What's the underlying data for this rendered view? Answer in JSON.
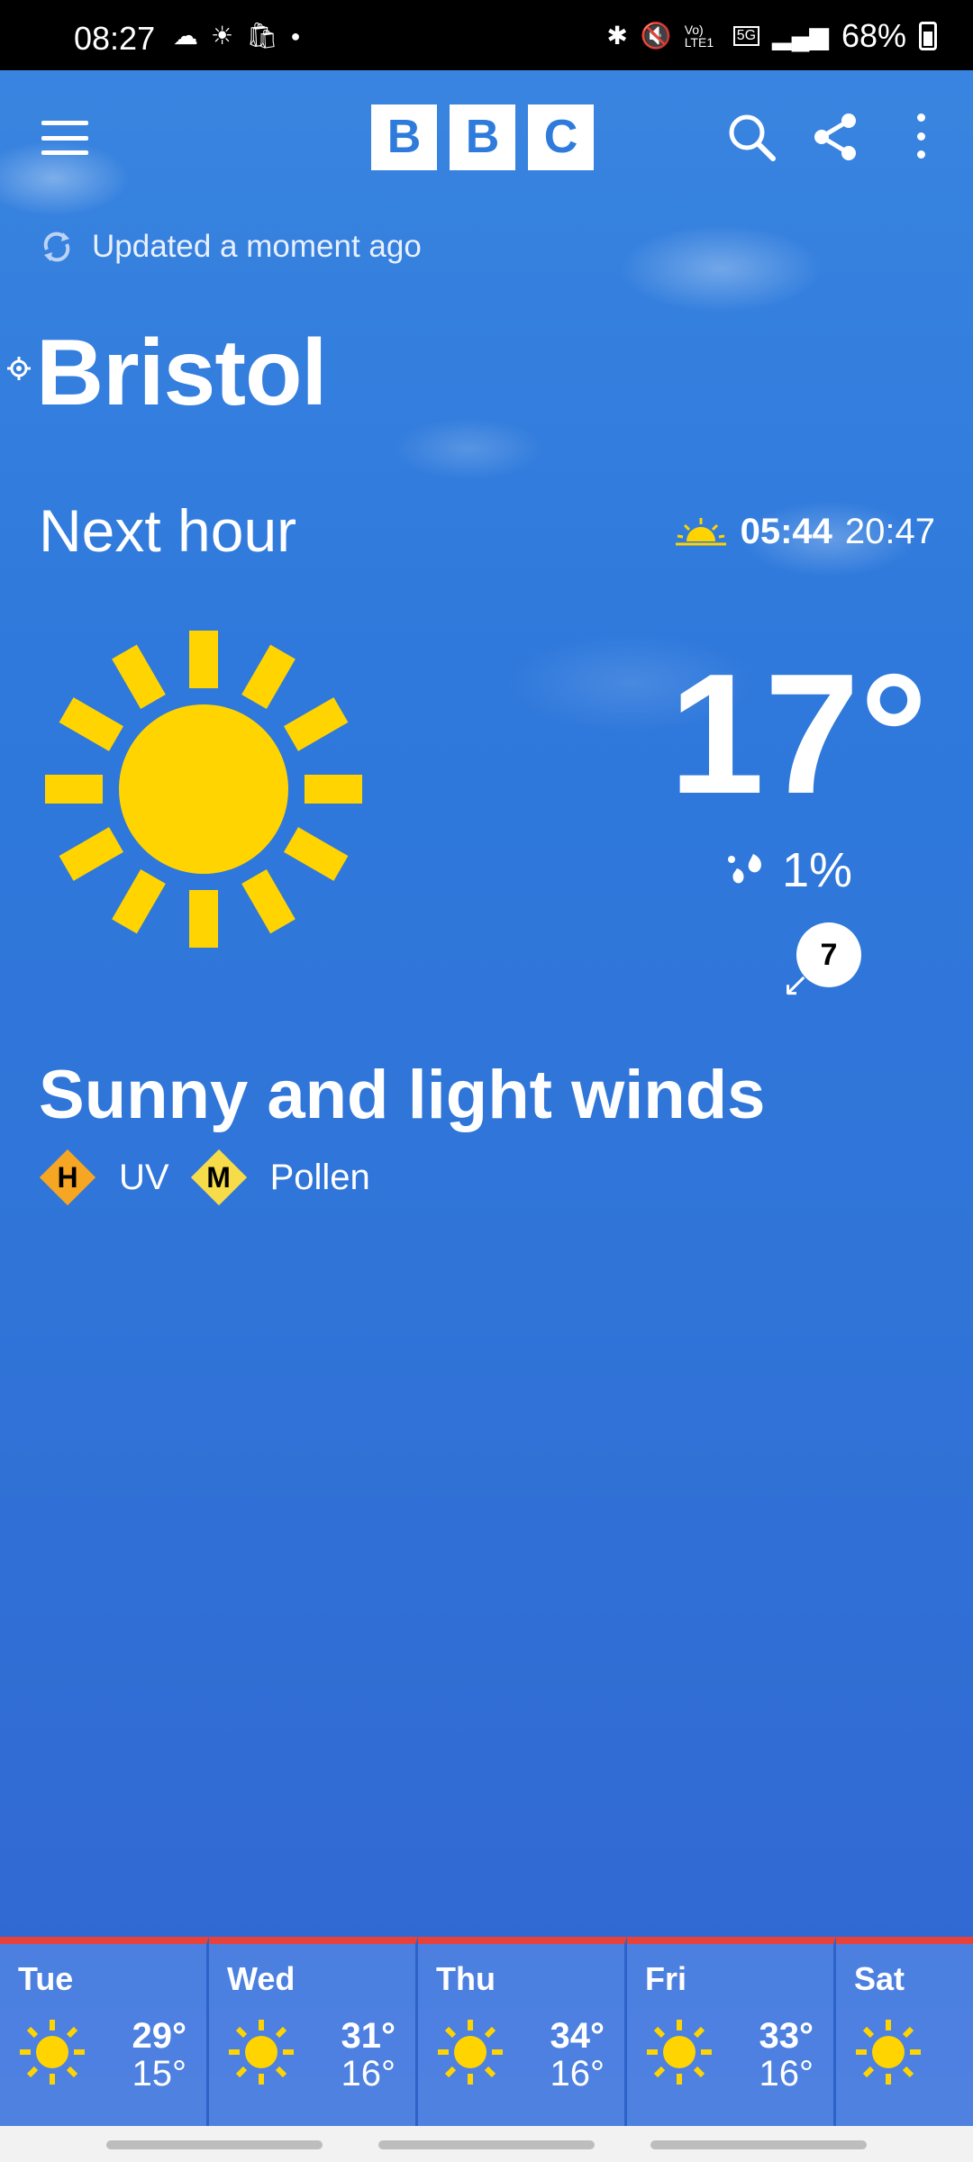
{
  "status_bar": {
    "time": "08:27",
    "network": "5G",
    "carrier": "Vo) LTE1",
    "battery": "68%"
  },
  "header": {
    "logo_letters": [
      "B",
      "B",
      "C"
    ]
  },
  "updated": {
    "text": "Updated a moment ago"
  },
  "location": {
    "city": "Bristol"
  },
  "now": {
    "label": "Next hour",
    "sunrise": "05:44",
    "sunset": "20:47",
    "temperature": "17°",
    "precipitation": "1%",
    "wind_speed": "7",
    "summary": "Sunny and light winds",
    "uv": {
      "level": "H",
      "label": "UV"
    },
    "pollen": {
      "level": "M",
      "label": "Pollen"
    }
  },
  "forecast": [
    {
      "day": "Tue",
      "high": "29°",
      "low": "15°"
    },
    {
      "day": "Wed",
      "high": "31°",
      "low": "16°"
    },
    {
      "day": "Thu",
      "high": "34°",
      "low": "16°"
    },
    {
      "day": "Fri",
      "high": "33°",
      "low": "16°"
    },
    {
      "day": "Sat",
      "high": "",
      "low": ""
    }
  ],
  "colors": {
    "accent_bar": "#e8413a",
    "sun": "#ffd400",
    "uv_high": "#f6a623",
    "pollen_med": "#f7dc4a"
  }
}
